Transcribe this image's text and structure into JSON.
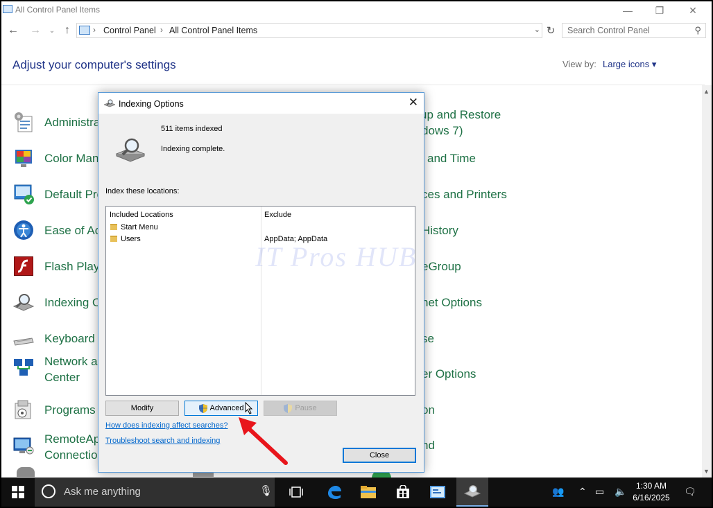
{
  "window": {
    "title": "All Control Panel Items",
    "minimize_glyph": "—",
    "maximize_glyph": "❐",
    "close_glyph": "✕"
  },
  "address": {
    "crumbs": [
      "Control Panel",
      "All Control Panel Items"
    ],
    "search_placeholder": "Search Control Panel"
  },
  "main": {
    "heading": "Adjust your computer's settings",
    "view_by_label": "View by:",
    "view_by_value": "Large icons ▾"
  },
  "items_left": [
    {
      "label": "Administra",
      "icon": "admin-tools-icon"
    },
    {
      "label": "Color Mana",
      "icon": "color-management-icon"
    },
    {
      "label": "Default Pro",
      "icon": "default-programs-icon"
    },
    {
      "label": "Ease of Acc",
      "icon": "ease-of-access-icon"
    },
    {
      "label": "Flash Playe",
      "icon": "flash-player-icon"
    },
    {
      "label": "Indexing O",
      "icon": "indexing-options-icon"
    },
    {
      "label": "Keyboard",
      "icon": "keyboard-icon"
    },
    {
      "label": "Network an",
      "label2": "Center",
      "icon": "network-sharing-icon"
    },
    {
      "label": "Programs a",
      "icon": "programs-features-icon"
    },
    {
      "label": "RemoteAp",
      "label2": "Connection",
      "icon": "remoteapp-icon"
    }
  ],
  "items_right": [
    {
      "label": "up and Restore"
    },
    {
      "label": "dows 7)"
    },
    {
      "label": "and Time"
    },
    {
      "label": "ces and Printers"
    },
    {
      "label": "History"
    },
    {
      "label": "eGroup"
    },
    {
      "label": "net Options"
    },
    {
      "label": "se"
    },
    {
      "label": "er Options"
    },
    {
      "label": "on"
    },
    {
      "label": "nd"
    }
  ],
  "dialog": {
    "title": "Indexing Options",
    "close_glyph": "✕",
    "items_indexed": "511 items indexed",
    "status": "Indexing complete.",
    "locations_label": "Index these locations:",
    "columns": {
      "included": "Included Locations",
      "exclude": "Exclude"
    },
    "rows": [
      {
        "location": "Start Menu",
        "exclude": ""
      },
      {
        "location": "Users",
        "exclude": "AppData; AppData"
      }
    ],
    "buttons": {
      "modify": "Modify",
      "advanced": "Advanced",
      "pause": "Pause",
      "close": "Close"
    },
    "links": {
      "how": "How does indexing affect searches?",
      "troubleshoot": "Troubleshoot search and indexing"
    }
  },
  "watermark": "IT Pros HUB",
  "taskbar": {
    "search_text": "Ask me anything",
    "time": "1:30 AM",
    "date": "6/16/2025"
  },
  "colors": {
    "link_green": "#1e7145",
    "heading_blue": "#1e3287",
    "accent": "#0078d7",
    "arrow_red": "#e8151b"
  }
}
